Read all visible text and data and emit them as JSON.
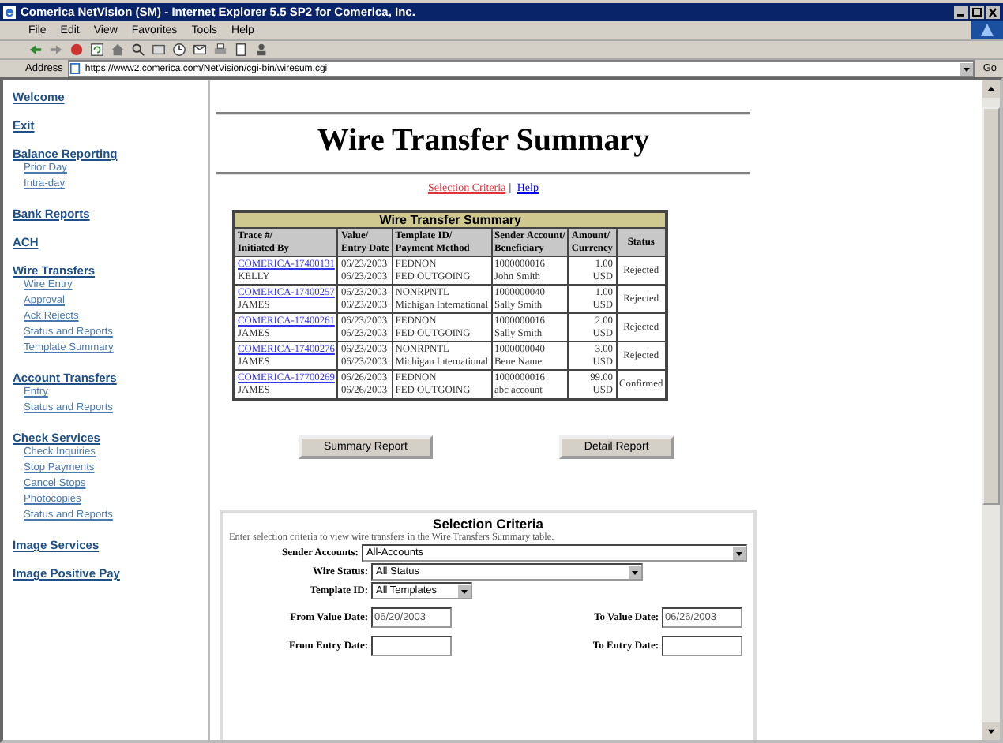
{
  "window": {
    "title": "Comerica NetVision (SM) - Internet Explorer 5.5 SP2 for Comerica, Inc."
  },
  "menu": [
    "File",
    "Edit",
    "View",
    "Favorites",
    "Tools",
    "Help"
  ],
  "address": {
    "label": "Address",
    "url": "https://www2.comerica.com/NetVision/cgi-bin/wiresum.cgi",
    "go": "Go"
  },
  "sidebar": [
    {
      "title": "Welcome"
    },
    {
      "title": "Exit"
    },
    {
      "title": "Balance Reporting",
      "children": [
        "Prior Day",
        "Intra-day"
      ]
    },
    {
      "title": "Bank Reports"
    },
    {
      "title": "ACH"
    },
    {
      "title": "Wire Transfers",
      "children": [
        "Wire Entry",
        "Approval",
        "Ack Rejects",
        "Status and Reports",
        "Template Summary"
      ]
    },
    {
      "title": "Account Transfers",
      "children": [
        "Entry",
        "Status and Reports"
      ]
    },
    {
      "title": "Check Services",
      "children": [
        "Check Inquiries",
        "Stop Payments",
        "Cancel Stops",
        "Photocopies",
        "Status and Reports"
      ]
    },
    {
      "title": "Image Services"
    },
    {
      "title": "Image Positive Pay"
    }
  ],
  "page_title": "Wire Transfer Summary",
  "links": [
    {
      "label": "Selection Criteria",
      "visited": true
    },
    {
      "label": "Help",
      "visited": false
    }
  ],
  "link_separator": "|",
  "table": {
    "caption": "Wire Transfer Summary",
    "columns": [
      [
        "Trace #/",
        "Initiated By"
      ],
      [
        "Value/",
        "Entry Date"
      ],
      [
        "Template ID/",
        "Payment Method"
      ],
      [
        "Sender Account/",
        "Beneficiary"
      ],
      [
        "Amount/",
        "Currency"
      ],
      [
        "Status"
      ]
    ],
    "rows": [
      {
        "trace": "COMERICA-17400131",
        "initiator": "KELLY",
        "value_date": "06/23/2003",
        "entry_date": "06/23/2003",
        "template": "FEDNON",
        "method": "FED OUTGOING",
        "account": "1000000016",
        "beneficiary": "John Smith",
        "amount": "1.00",
        "currency": "USD",
        "status": "Rejected"
      },
      {
        "trace": "COMERICA-17400257",
        "initiator": "JAMES",
        "value_date": "06/23/2003",
        "entry_date": "06/23/2003",
        "template": "NONRPNTL",
        "method": "Michigan International",
        "account": "1000000040",
        "beneficiary": "Sally Smith",
        "amount": "1.00",
        "currency": "USD",
        "status": "Rejected"
      },
      {
        "trace": "COMERICA-17400261",
        "initiator": "JAMES",
        "value_date": "06/23/2003",
        "entry_date": "06/23/2003",
        "template": "FEDNON",
        "method": "FED OUTGOING",
        "account": "1000000016",
        "beneficiary": "Sally Smith",
        "amount": "2.00",
        "currency": "USD",
        "status": "Rejected"
      },
      {
        "trace": "COMERICA-17400276",
        "initiator": "JAMES",
        "value_date": "06/23/2003",
        "entry_date": "06/23/2003",
        "template": "NONRPNTL",
        "method": "Michigan International",
        "account": "1000000040",
        "beneficiary": "Bene Name",
        "amount": "3.00",
        "currency": "USD",
        "status": "Rejected"
      },
      {
        "trace": "COMERICA-17700269",
        "initiator": "JAMES",
        "value_date": "06/26/2003",
        "entry_date": "06/26/2003",
        "template": "FEDNON",
        "method": "FED OUTGOING",
        "account": "1000000016",
        "beneficiary": "abc account",
        "amount": "99.00",
        "currency": "USD",
        "status": "Confirmed"
      }
    ]
  },
  "buttons": [
    "Summary Report",
    "Detail Report"
  ],
  "criteria": {
    "title": "Selection Criteria",
    "intro": "Enter selection criteria to view wire transfers in the Wire Transfers Summary table.",
    "selects": [
      {
        "label": "Sender Accounts:",
        "value": "All-Accounts"
      },
      {
        "label": "Wire Status:",
        "value": "All Status"
      },
      {
        "label": "Template ID:",
        "value": "All Templates"
      }
    ],
    "date_rows": [
      [
        {
          "label": "From Value Date:",
          "value": "06/20/2003"
        },
        {
          "label": "To Value Date:",
          "value": "06/26/2003"
        }
      ],
      [
        {
          "label": "From Entry Date:"
        },
        {
          "label": "To Entry Date:"
        }
      ]
    ]
  }
}
